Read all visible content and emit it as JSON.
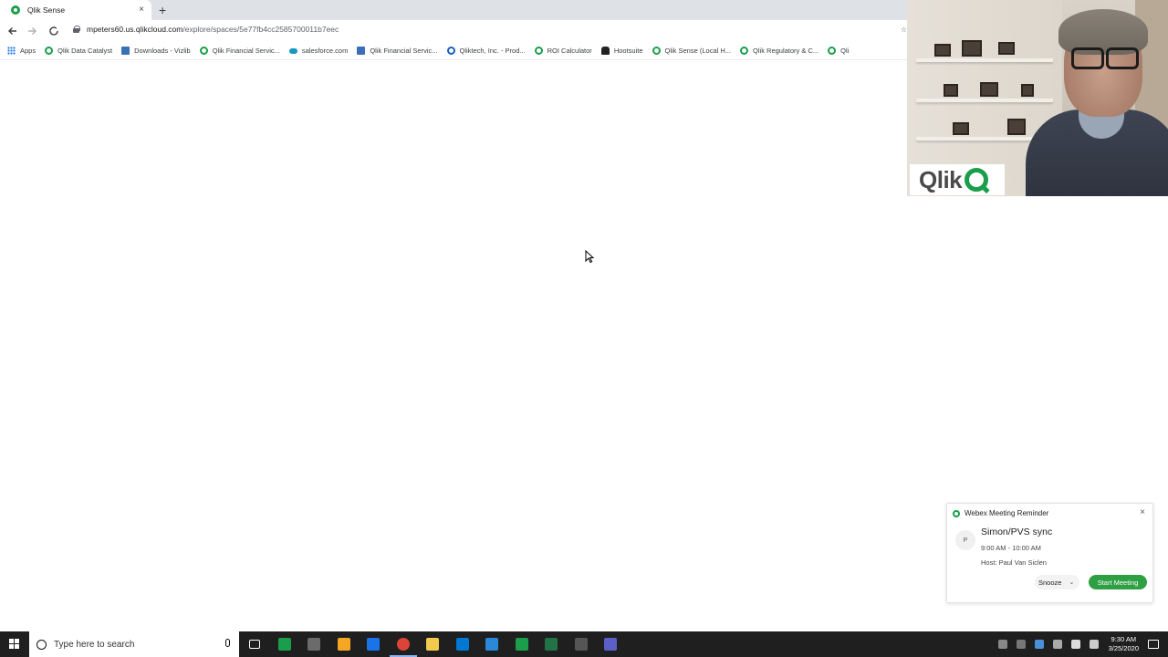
{
  "browser": {
    "tab_title": "Qlik Sense",
    "tab_close": "×",
    "new_tab": "+",
    "url_host": "mpeters60.us.qlikcloud.com",
    "url_path": "/explore/spaces/5e77fb4cc2585700011b7eec",
    "bookmark_star": "☆",
    "bookmarks": [
      {
        "label": "Apps",
        "icon": "apps-grid-icon"
      },
      {
        "label": "Qlik Data Catalyst",
        "icon": "qlik-icon"
      },
      {
        "label": "Downloads - Vizlib",
        "icon": "doc-icon"
      },
      {
        "label": "Qlik Financial Servic...",
        "icon": "qlik-icon"
      },
      {
        "label": "salesforce.com",
        "icon": "cloud-icon"
      },
      {
        "label": "Qlik Financial Servic...",
        "icon": "doc-icon"
      },
      {
        "label": "Qliktech, Inc. - Prod...",
        "icon": "circle-icon"
      },
      {
        "label": "ROI Calculator",
        "icon": "qlik-icon"
      },
      {
        "label": "Hootsuite",
        "icon": "owl-icon"
      },
      {
        "label": "Qlik Sense (Local H...",
        "icon": "qlik-icon"
      },
      {
        "label": "Qlik Regulatory & C...",
        "icon": "qlik-icon"
      },
      {
        "label": "Qli",
        "icon": "qlik-icon"
      }
    ]
  },
  "webcam": {
    "logo_text": "Qlik",
    "logo_color": "#1a9e4b"
  },
  "reminder": {
    "app": "Webex Meeting Reminder",
    "close": "×",
    "avatar_initial": "P",
    "meeting_title": "Simon/PVS sync",
    "time": "9:00 AM - 10:00 AM",
    "host": "Host: Paul Van Siclen",
    "snooze_label": "Snooze",
    "snooze_chevron": "⌄",
    "start_label": "Start Meeting",
    "start_color": "#2ea043"
  },
  "taskbar": {
    "search_placeholder": "Type here to search",
    "clock_time": "9:30 AM",
    "clock_date": "3/25/2020",
    "apps": [
      {
        "name": "task-view",
        "color": "#1f1f1f"
      },
      {
        "name": "sheets",
        "color": "#1a9e4b"
      },
      {
        "name": "app-2",
        "color": "#6b6b6b"
      },
      {
        "name": "store",
        "color": "#f5a623"
      },
      {
        "name": "onepassword",
        "color": "#1a73e8"
      },
      {
        "name": "chrome",
        "color": "#db4437"
      },
      {
        "name": "file-explorer",
        "color": "#f2c94c"
      },
      {
        "name": "outlook",
        "color": "#0078d4"
      },
      {
        "name": "app-8",
        "color": "#2b88d8"
      },
      {
        "name": "qlik",
        "color": "#1a9e4b"
      },
      {
        "name": "excel",
        "color": "#217346"
      },
      {
        "name": "app-11",
        "color": "#555555"
      },
      {
        "name": "teams",
        "color": "#5b5fc7"
      }
    ]
  }
}
